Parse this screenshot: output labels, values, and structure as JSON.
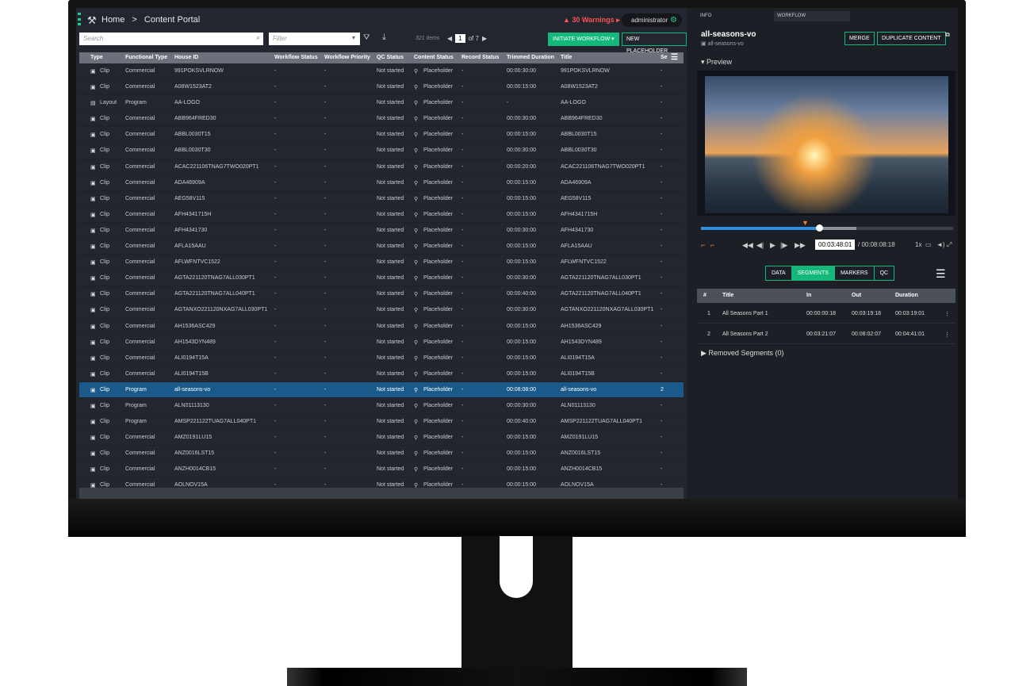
{
  "header": {
    "home": "Home",
    "separator": ">",
    "page": "Content Portal",
    "warnings": "30 Warnings",
    "user": "administrator"
  },
  "toolbar": {
    "search_placeholder": "Search",
    "filter_placeholder": "Filter",
    "items_count": "321 items",
    "page_current": "1",
    "page_total": "of 7",
    "initiate_workflow": "INITIATE WORKFLOW",
    "new_placeholder": "NEW PLACEHOLDER"
  },
  "table": {
    "columns": [
      "Type",
      "Functional Type",
      "House ID",
      "Workflow Status",
      "Workflow Priority",
      "QC Status",
      "Content Status",
      "Record Status",
      "Trimmed Duration",
      "Title",
      "Se"
    ],
    "rows": [
      [
        "Clip",
        "Commercial",
        "991POKSVLRNOW",
        "-",
        "-",
        "Not started",
        "Placeholder",
        "-",
        "00:00:30:00",
        "991POKSVLRNOW",
        "-"
      ],
      [
        "Clip",
        "Commercial",
        "A08W1523AT2",
        "-",
        "-",
        "Not started",
        "Placeholder",
        "-",
        "00:00:15:00",
        "A08W1523AT2",
        "-"
      ],
      [
        "Layout",
        "Program",
        "AA-LOGO",
        "-",
        "-",
        "Not started",
        "Placeholder",
        "-",
        "-",
        "AA-LOGO",
        "-"
      ],
      [
        "Clip",
        "Commercial",
        "ABB964FRED30",
        "-",
        "-",
        "Not started",
        "Placeholder",
        "-",
        "00:00:30:00",
        "ABB964FRED30",
        "-"
      ],
      [
        "Clip",
        "Commercial",
        "ABBL0030T15",
        "-",
        "-",
        "Not started",
        "Placeholder",
        "-",
        "00:00:15:00",
        "ABBL0030T15",
        "-"
      ],
      [
        "Clip",
        "Commercial",
        "ABBL0030T30",
        "-",
        "-",
        "Not started",
        "Placeholder",
        "-",
        "00:00:30:00",
        "ABBL0030T30",
        "-"
      ],
      [
        "Clip",
        "Commercial",
        "ACAC221106TNAG7TWO020PT1",
        "-",
        "-",
        "Not started",
        "Placeholder",
        "-",
        "00:00:20:00",
        "ACAC221106TNAG7TWO020PT1",
        "-"
      ],
      [
        "Clip",
        "Commercial",
        "ADA46909A",
        "-",
        "-",
        "Not started",
        "Placeholder",
        "-",
        "00:00:15:00",
        "ADA46909A",
        "-"
      ],
      [
        "Clip",
        "Commercial",
        "AEG58V115",
        "-",
        "-",
        "Not started",
        "Placeholder",
        "-",
        "00:00:15:00",
        "AEG58V115",
        "-"
      ],
      [
        "Clip",
        "Commercial",
        "AFH4341715H",
        "-",
        "-",
        "Not started",
        "Placeholder",
        "-",
        "00:00:15:00",
        "AFH4341715H",
        "-"
      ],
      [
        "Clip",
        "Commercial",
        "AFH4341730",
        "-",
        "-",
        "Not started",
        "Placeholder",
        "-",
        "00:00:30:00",
        "AFH4341730",
        "-"
      ],
      [
        "Clip",
        "Commercial",
        "AFLA15AAU",
        "-",
        "-",
        "Not started",
        "Placeholder",
        "-",
        "00:00:15:00",
        "AFLA15AAU",
        "-"
      ],
      [
        "Clip",
        "Commercial",
        "AFLWFNTVC1522",
        "-",
        "-",
        "Not started",
        "Placeholder",
        "-",
        "00:00:15:00",
        "AFLWFNTVC1522",
        "-"
      ],
      [
        "Clip",
        "Commercial",
        "AGTA221120TNAG7ALL030PT1",
        "-",
        "-",
        "Not started",
        "Placeholder",
        "-",
        "00:00:30:00",
        "AGTA221120TNAG7ALL030PT1",
        "-"
      ],
      [
        "Clip",
        "Commercial",
        "AGTA221120TNAG7ALL040PT1",
        "-",
        "-",
        "Not started",
        "Placeholder",
        "-",
        "00:00:40:00",
        "AGTA221120TNAG7ALL040PT1",
        "-"
      ],
      [
        "Clip",
        "Commercial",
        "AGTANXO221120NXAG7ALL030PT1",
        "-",
        "-",
        "Not started",
        "Placeholder",
        "-",
        "00:00:30:00",
        "AGTANXO221120NXAG7ALL030PT1",
        "-"
      ],
      [
        "Clip",
        "Commercial",
        "AH1536ASC429",
        "-",
        "-",
        "Not started",
        "Placeholder",
        "-",
        "00:00:15:00",
        "AH1536ASC429",
        "-"
      ],
      [
        "Clip",
        "Commercial",
        "AH1543DYN489",
        "-",
        "-",
        "Not started",
        "Placeholder",
        "-",
        "00:00:15:00",
        "AH1543DYN489",
        "-"
      ],
      [
        "Clip",
        "Commercial",
        "ALI0194T15A",
        "-",
        "-",
        "Not started",
        "Placeholder",
        "-",
        "00:00:15:00",
        "ALI0194T15A",
        "-"
      ],
      [
        "Clip",
        "Commercial",
        "ALI0194T15B",
        "-",
        "-",
        "Not started",
        "Placeholder",
        "-",
        "00:00:15:00",
        "ALI0194T15B",
        "-"
      ],
      [
        "Clip",
        "Program",
        "all-seasons-vo",
        "-",
        "-",
        "Not started",
        "Placeholder",
        "-",
        "00:08:08:00",
        "all-seasons-vo",
        "2"
      ],
      [
        "Clip",
        "Program",
        "ALN01113130",
        "-",
        "-",
        "Not started",
        "Placeholder",
        "-",
        "00:00:30:00",
        "ALN01113130",
        "-"
      ],
      [
        "Clip",
        "Program",
        "AMSP221122TUAG7ALL040PT1",
        "-",
        "-",
        "Not started",
        "Placeholder",
        "-",
        "00:00:40:00",
        "AMSP221122TUAG7ALL040PT1",
        "-"
      ],
      [
        "Clip",
        "Commercial",
        "AMZ0191LU15",
        "-",
        "-",
        "Not started",
        "Placeholder",
        "-",
        "00:00:15:00",
        "AMZ0191LU15",
        "-"
      ],
      [
        "Clip",
        "Commercial",
        "ANZ0016LST15",
        "-",
        "-",
        "Not started",
        "Placeholder",
        "-",
        "00:00:15:00",
        "ANZ0016LST15",
        "-"
      ],
      [
        "Clip",
        "Commercial",
        "ANZH0014CB15",
        "-",
        "-",
        "Not started",
        "Placeholder",
        "-",
        "00:00:15:00",
        "ANZH0014CB15",
        "-"
      ],
      [
        "Clip",
        "Commercial",
        "AOLNOV15A",
        "-",
        "-",
        "Not started",
        "Placeholder",
        "-",
        "00:00:15:00",
        "AOLNOV15A",
        "-"
      ]
    ],
    "selected_row": 20
  },
  "panel": {
    "tab_info": "INFO",
    "tab_workflow": "WORKFLOW",
    "asset_title": "all-seasons-vo",
    "asset_sub": "all-seasons-vo",
    "merge": "MERGE",
    "duplicate": "DUPLICATE CONTENT",
    "preview": "Preview",
    "current_time": "00:03:48:01",
    "duration": "/ 00:08:08:18",
    "speed": "1x",
    "playback_progress": 0.467,
    "tabs": [
      "DATA",
      "SEGMENTS",
      "MARKERS",
      "QC"
    ],
    "active_tab": "SEGMENTS",
    "seg_columns": [
      "#",
      "Title",
      "In",
      "Out",
      "Duration"
    ],
    "segments": [
      [
        "1",
        "All Seasons Part 1",
        "00:00:00:18",
        "00:03:19:18",
        "00:03:19:01"
      ],
      [
        "2",
        "All Seasons Part 2",
        "00:03:21:07",
        "00:08:02:07",
        "00:04:41:01"
      ]
    ],
    "removed": "Removed Segments (0)"
  },
  "colors": {
    "accent": "#14b87a",
    "warning": "#ff5252",
    "selected": "#1a5a8a",
    "progress": "#2f90e0"
  }
}
